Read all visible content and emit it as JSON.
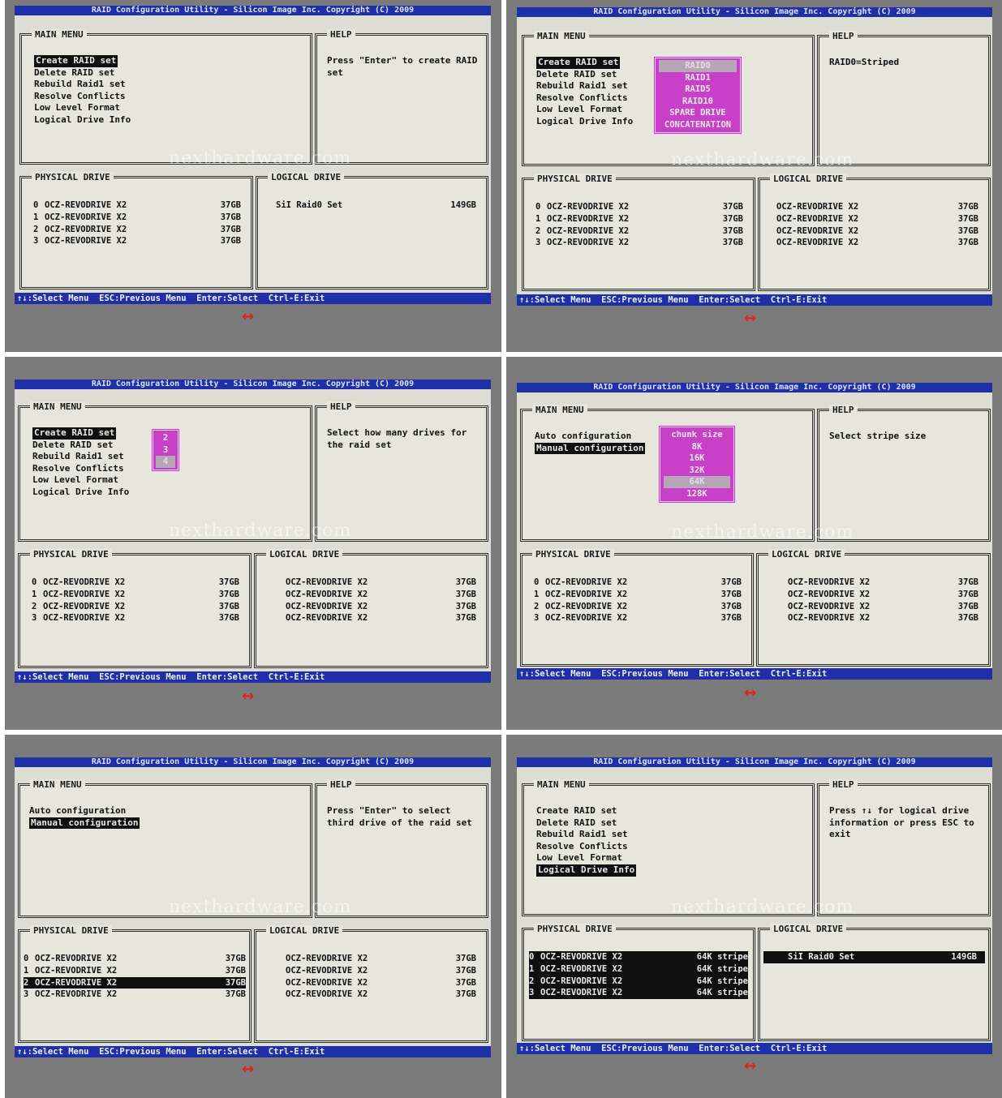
{
  "title_text": "RAID Configuration Utility - Silicon Image Inc. Copyright (C) 2009",
  "panel_titles": {
    "main": "MAIN MENU",
    "help": "HELP",
    "physical": "PHYSICAL DRIVE",
    "logical": "LOGICAL DRIVE"
  },
  "status_bar": "↑↓:Select Menu  ESC:Previous Menu  Enter:Select  Ctrl-E:Exit",
  "watermark": "nexthardware.com",
  "nav_arrow": "↔",
  "main_menu_items": [
    "Create RAID set",
    "Delete RAID set",
    "Rebuild Raid1 set",
    "Resolve Conflicts",
    "Low Level Format",
    "Logical Drive Info"
  ],
  "config_menu_items": [
    "Auto configuration",
    "Manual configuration"
  ],
  "physical_drives": [
    {
      "num": "0",
      "name": "OCZ-REVODRIVE X2",
      "size": "37GB"
    },
    {
      "num": "1",
      "name": "OCZ-REVODRIVE X2",
      "size": "37GB"
    },
    {
      "num": "2",
      "name": "OCZ-REVODRIVE X2",
      "size": "37GB"
    },
    {
      "num": "3",
      "name": "OCZ-REVODRIVE X2",
      "size": "37GB"
    }
  ],
  "logical_set": {
    "name": "SiI Raid0 Set",
    "size": "149GB"
  },
  "panels": [
    {
      "help": "Press \"Enter\" to create RAID set"
    },
    {
      "help": "RAID0=Striped",
      "popup": [
        "RAID0",
        "RAID1",
        "RAID5",
        "RAID10",
        "SPARE DRIVE",
        "CONCATENATION"
      ]
    },
    {
      "help": "Select how many drives for the raid set",
      "popup": [
        "2",
        "3",
        "4"
      ]
    },
    {
      "help": "Select stripe size",
      "popup": [
        "chunk size",
        "8K",
        "16K",
        "32K",
        "64K",
        "128K"
      ]
    },
    {
      "help": "Press \"Enter\" to select third drive of the raid set"
    },
    {
      "help": "Press ↑↓ for logical drive information or press ESC to exit",
      "stripe_label": "64K stripe"
    }
  ]
}
